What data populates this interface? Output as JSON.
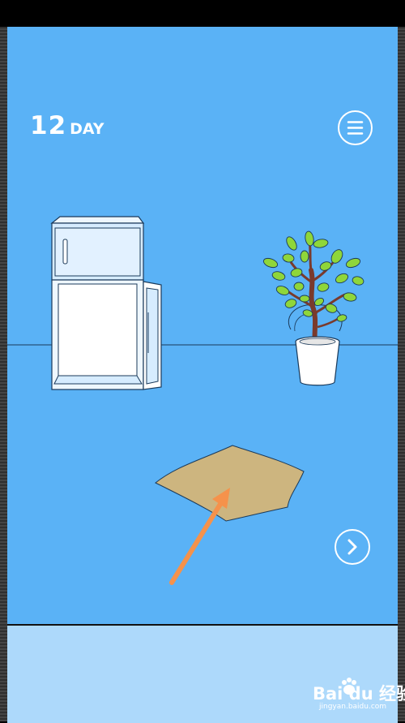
{
  "hud": {
    "day_number": "12",
    "day_label": "DAY",
    "menu_icon": "hamburger-menu-icon",
    "next_icon": "chevron-right-icon"
  },
  "scene": {
    "objects": [
      "refrigerator",
      "potted-plant",
      "sack",
      "hint-arrow"
    ],
    "colors": {
      "background": "#5ab2f6",
      "bottom_panel": "#add9fb",
      "sack": "#cdb57f",
      "arrow": "#f5924b",
      "leaves": "#8fd63a",
      "trunk": "#7a3a2c"
    }
  },
  "watermark": {
    "brand": "Bai du 经验",
    "url": "jingyan.baidu.com"
  }
}
